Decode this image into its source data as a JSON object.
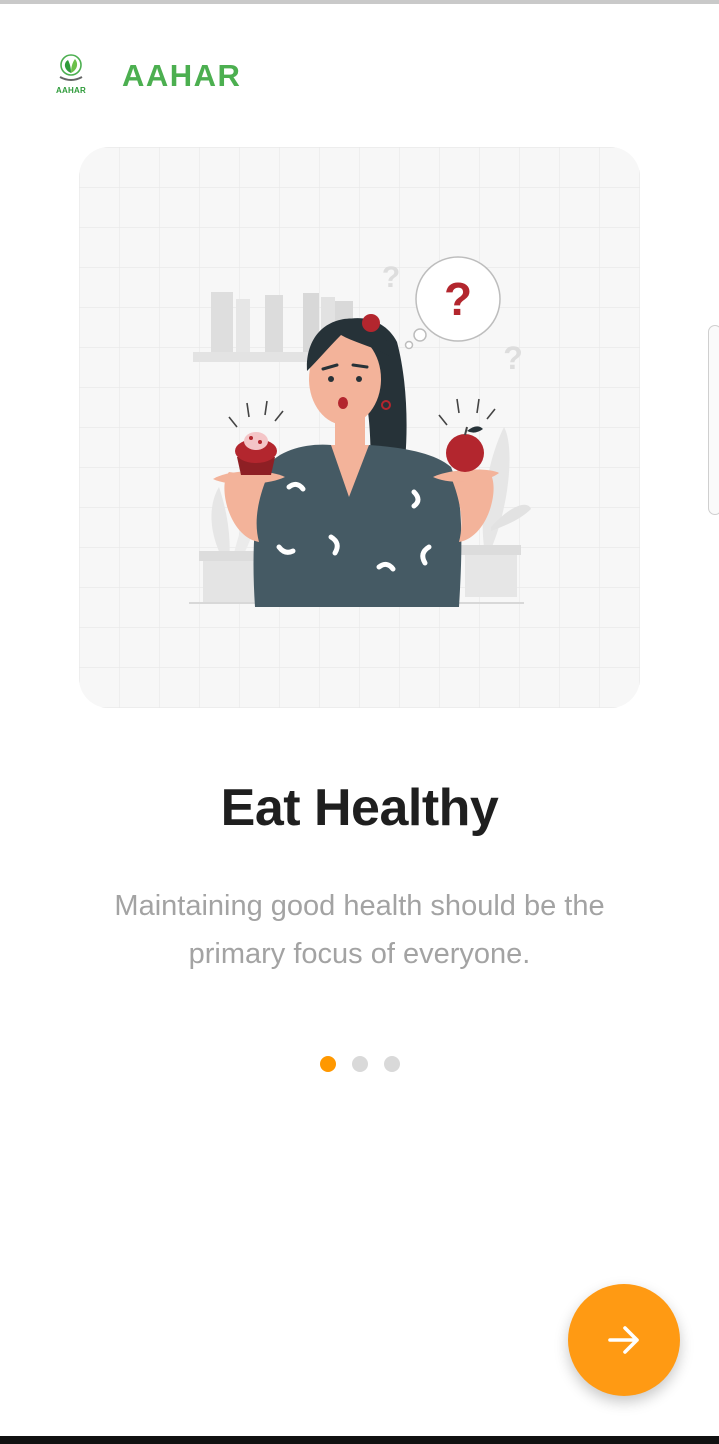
{
  "header": {
    "logo_caption": "AAHAR",
    "brand_name": "AAHAR"
  },
  "onboarding": {
    "illustration_icon": "woman-choosing-cupcake-or-apple-illustration",
    "title": "Eat Healthy",
    "description": "Maintaining good health should be the primary focus of everyone.",
    "page_count": 3,
    "active_page": 1
  },
  "actions": {
    "next_icon": "arrow-right-icon"
  },
  "colors": {
    "brand_green": "#4caf50",
    "accent_orange": "#ff9800",
    "title_text": "#1f1f1f",
    "body_text": "#a3a3a3"
  }
}
